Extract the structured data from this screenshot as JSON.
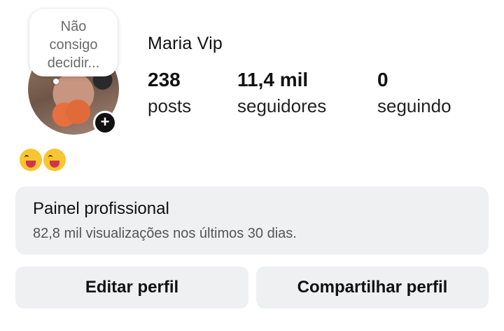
{
  "profile": {
    "note": [
      "Não",
      "consigo",
      "decidir..."
    ],
    "name": "Maria Vip",
    "add_badge": "+",
    "stats": {
      "posts": {
        "value": "238",
        "label": "posts"
      },
      "followers": {
        "value": "11,4 mil",
        "label": "seguidores"
      },
      "following": {
        "value": "0",
        "label": "seguindo"
      }
    },
    "bio_emojis": [
      "tongue-wink-emoji",
      "tongue-wink-emoji"
    ]
  },
  "dashboard": {
    "title": "Painel profissional",
    "subtitle": "82,8 mil visualizações nos últimos 30 dias."
  },
  "actions": {
    "edit_label": "Editar perfil",
    "share_label": "Compartilhar perfil"
  },
  "colors": {
    "button_bg": "#eff0f2",
    "text": "#111111"
  }
}
